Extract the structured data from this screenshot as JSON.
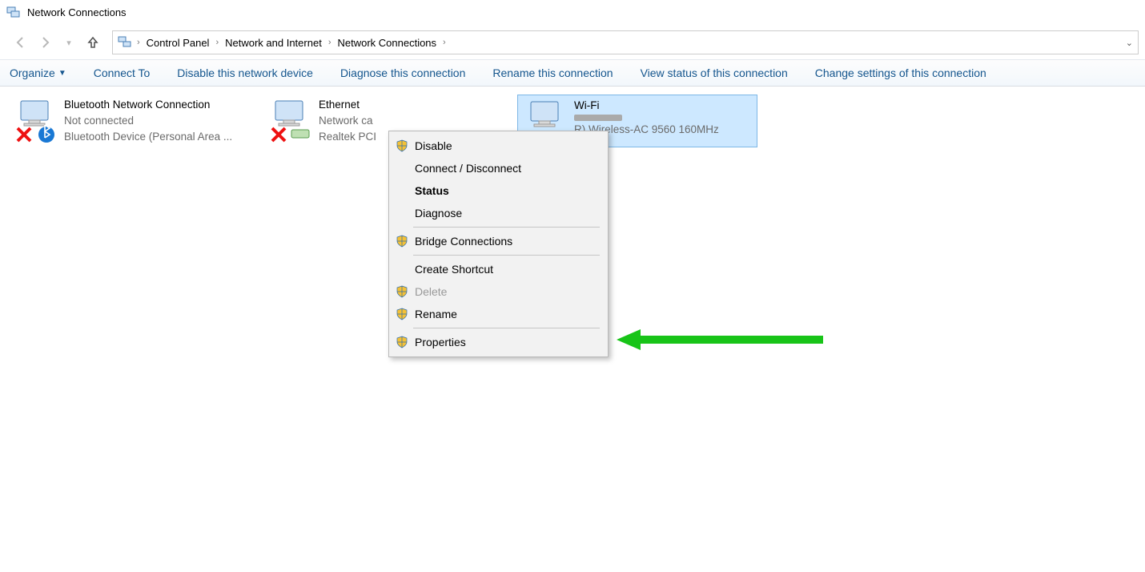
{
  "window": {
    "title": "Network Connections"
  },
  "breadcrumb": {
    "items": [
      "Control Panel",
      "Network and Internet",
      "Network Connections"
    ]
  },
  "toolbar": {
    "organize": "Organize",
    "connect_to": "Connect To",
    "disable": "Disable this network device",
    "diagnose": "Diagnose this connection",
    "rename": "Rename this connection",
    "view_status": "View status of this connection",
    "change_settings": "Change settings of this connection"
  },
  "connections": [
    {
      "name": "Bluetooth Network Connection",
      "line2": "Not connected",
      "line3": "Bluetooth Device (Personal Area ..."
    },
    {
      "name": "Ethernet",
      "line2": "Network ca",
      "line3": "Realtek PCI"
    },
    {
      "name": "Wi-Fi",
      "line2": "",
      "line3": "R) Wireless-AC 9560 160MHz"
    }
  ],
  "context_menu": {
    "disable": "Disable",
    "connect_disconnect": "Connect / Disconnect",
    "status": "Status",
    "diagnose": "Diagnose",
    "bridge": "Bridge Connections",
    "create_shortcut": "Create Shortcut",
    "delete": "Delete",
    "rename": "Rename",
    "properties": "Properties"
  }
}
